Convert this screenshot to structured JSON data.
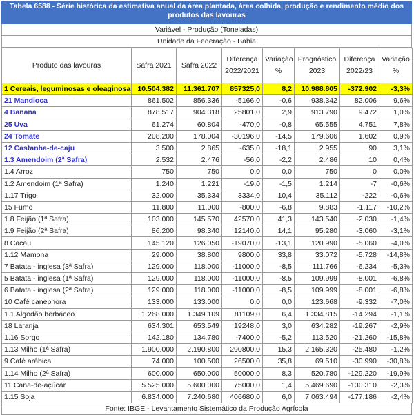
{
  "title": "Tabela 6588 - Série histórica da estimativa anual da área plantada, área colhida, produção e rendimento médio dos produtos das lavouras",
  "variable": "Variável - Produção (Toneladas)",
  "unit": "Unidade da Federação - Bahia",
  "headers": {
    "product": "Produto das lavouras",
    "s2021": "Safra 2021",
    "s2022": "Safra 2022",
    "diff1": "Diferença 2022/2021",
    "var1": "Variação %",
    "prog": "Prognóstico 2023",
    "diff2": "Diferença 2022/23",
    "var2": "Variação %"
  },
  "rows": [
    {
      "product": "1 Cereais, leguminosas e oleaginosas",
      "s2021": "10.504.382",
      "s2022": "11.361.707",
      "diff1": "857325,0",
      "var1": "8,2",
      "prog": "10.988.805",
      "diff2": "-372.902",
      "var2": "-3,3%"
    },
    {
      "product": "21 Mandioca",
      "s2021": "861.502",
      "s2022": "856.336",
      "diff1": "-5166,0",
      "var1": "-0,6",
      "prog": "938.342",
      "diff2": "82.006",
      "var2": "9,6%"
    },
    {
      "product": "4 Banana",
      "s2021": "878.517",
      "s2022": "904.318",
      "diff1": "25801,0",
      "var1": "2,9",
      "prog": "913.790",
      "diff2": "9.472",
      "var2": "1,0%"
    },
    {
      "product": "25 Uva",
      "s2021": "61.274",
      "s2022": "60.804",
      "diff1": "-470,0",
      "var1": "-0,8",
      "prog": "65.555",
      "diff2": "4.751",
      "var2": "7,8%"
    },
    {
      "product": "24 Tomate",
      "s2021": "208.200",
      "s2022": "178.004",
      "diff1": "-30196,0",
      "var1": "-14,5",
      "prog": "179.606",
      "diff2": "1.602",
      "var2": "0,9%"
    },
    {
      "product": "12 Castanha-de-caju",
      "s2021": "3.500",
      "s2022": "2.865",
      "diff1": "-635,0",
      "var1": "-18,1",
      "prog": "2.955",
      "diff2": "90",
      "var2": "3,1%"
    },
    {
      "product": "1.3 Amendoim (2ª Safra)",
      "s2021": "2.532",
      "s2022": "2.476",
      "diff1": "-56,0",
      "var1": "-2,2",
      "prog": "2.486",
      "diff2": "10",
      "var2": "0,4%"
    },
    {
      "product": "1.4 Arroz",
      "s2021": "750",
      "s2022": "750",
      "diff1": "0,0",
      "var1": "0,0",
      "prog": "750",
      "diff2": "0",
      "var2": "0,0%"
    },
    {
      "product": "1.2 Amendoim (1ª Safra)",
      "s2021": "1.240",
      "s2022": "1.221",
      "diff1": "-19,0",
      "var1": "-1,5",
      "prog": "1.214",
      "diff2": "-7",
      "var2": "-0,6%"
    },
    {
      "product": "1.17 Trigo",
      "s2021": "32.000",
      "s2022": "35.334",
      "diff1": "3334,0",
      "var1": "10,4",
      "prog": "35.112",
      "diff2": "-222",
      "var2": "-0,6%"
    },
    {
      "product": "15 Fumo",
      "s2021": "11.800",
      "s2022": "11.000",
      "diff1": "-800,0",
      "var1": "-6,8",
      "prog": "9.883",
      "diff2": "-1.117",
      "var2": "-10,2%"
    },
    {
      "product": "1.8 Feijão (1ª Safra)",
      "s2021": "103.000",
      "s2022": "145.570",
      "diff1": "42570,0",
      "var1": "41,3",
      "prog": "143.540",
      "diff2": "-2.030",
      "var2": "-1,4%"
    },
    {
      "product": "1.9 Feijão (2ª Safra)",
      "s2021": "86.200",
      "s2022": "98.340",
      "diff1": "12140,0",
      "var1": "14,1",
      "prog": "95.280",
      "diff2": "-3.060",
      "var2": "-3,1%"
    },
    {
      "product": "8 Cacau",
      "s2021": "145.120",
      "s2022": "126.050",
      "diff1": "-19070,0",
      "var1": "-13,1",
      "prog": "120.990",
      "diff2": "-5.060",
      "var2": "-4,0%"
    },
    {
      "product": "1.12 Mamona",
      "s2021": "29.000",
      "s2022": "38.800",
      "diff1": "9800,0",
      "var1": "33,8",
      "prog": "33.072",
      "diff2": "-5.728",
      "var2": "-14,8%"
    },
    {
      "product": "7 Batata - inglesa (3ª Safra)",
      "s2021": "129.000",
      "s2022": "118.000",
      "diff1": "-11000,0",
      "var1": "-8,5",
      "prog": "111.766",
      "diff2": "-6.234",
      "var2": "-5,3%"
    },
    {
      "product": "5 Batata - inglesa (1ª Safra)",
      "s2021": "129.000",
      "s2022": "118.000",
      "diff1": "-11000,0",
      "var1": "-8,5",
      "prog": "109.999",
      "diff2": "-8.001",
      "var2": "-6,8%"
    },
    {
      "product": "6 Batata - inglesa (2ª Safra)",
      "s2021": "129.000",
      "s2022": "118.000",
      "diff1": "-11000,0",
      "var1": "-8,5",
      "prog": "109.999",
      "diff2": "-8.001",
      "var2": "-6,8%"
    },
    {
      "product": "10 Café canephora",
      "s2021": "133.000",
      "s2022": "133.000",
      "diff1": "0,0",
      "var1": "0,0",
      "prog": "123.668",
      "diff2": "-9.332",
      "var2": "-7,0%"
    },
    {
      "product": "1.1 Algodão herbáceo",
      "s2021": "1.268.000",
      "s2022": "1.349.109",
      "diff1": "81109,0",
      "var1": "6,4",
      "prog": "1.334.815",
      "diff2": "-14.294",
      "var2": "-1,1%"
    },
    {
      "product": "18 Laranja",
      "s2021": "634.301",
      "s2022": "653.549",
      "diff1": "19248,0",
      "var1": "3,0",
      "prog": "634.282",
      "diff2": "-19.267",
      "var2": "-2,9%"
    },
    {
      "product": "1.16 Sorgo",
      "s2021": "142.180",
      "s2022": "134.780",
      "diff1": "-7400,0",
      "var1": "-5,2",
      "prog": "113.520",
      "diff2": "-21.260",
      "var2": "-15,8%"
    },
    {
      "product": "1.13 Milho (1ª Safra)",
      "s2021": "1.900.000",
      "s2022": "2.190.800",
      "diff1": "290800,0",
      "var1": "15,3",
      "prog": "2.165.320",
      "diff2": "-25.480",
      "var2": "-1,2%"
    },
    {
      "product": "9 Café arábica",
      "s2021": "74.000",
      "s2022": "100.500",
      "diff1": "26500,0",
      "var1": "35,8",
      "prog": "69.510",
      "diff2": "-30.990",
      "var2": "-30,8%"
    },
    {
      "product": "1.14 Milho (2ª Safra)",
      "s2021": "600.000",
      "s2022": "650.000",
      "diff1": "50000,0",
      "var1": "8,3",
      "prog": "520.780",
      "diff2": "-129.220",
      "var2": "-19,9%"
    },
    {
      "product": "11 Cana-de-açúcar",
      "s2021": "5.525.000",
      "s2022": "5.600.000",
      "diff1": "75000,0",
      "var1": "1,4",
      "prog": "5.469.690",
      "diff2": "-130.310",
      "var2": "-2,3%"
    },
    {
      "product": "1.15 Soja",
      "s2021": "6.834.000",
      "s2022": "7.240.680",
      "diff1": "406680,0",
      "var1": "6,0",
      "prog": "7.063.494",
      "diff2": "-177.186",
      "var2": "-2,4%"
    }
  ],
  "footer": "Fonte: IBGE - Levantamento Sistemático da Produção Agrícola",
  "colors": {
    "title_bg": "#4472c4",
    "highlight": "#ffff00",
    "blue_text": "#3333cc"
  }
}
